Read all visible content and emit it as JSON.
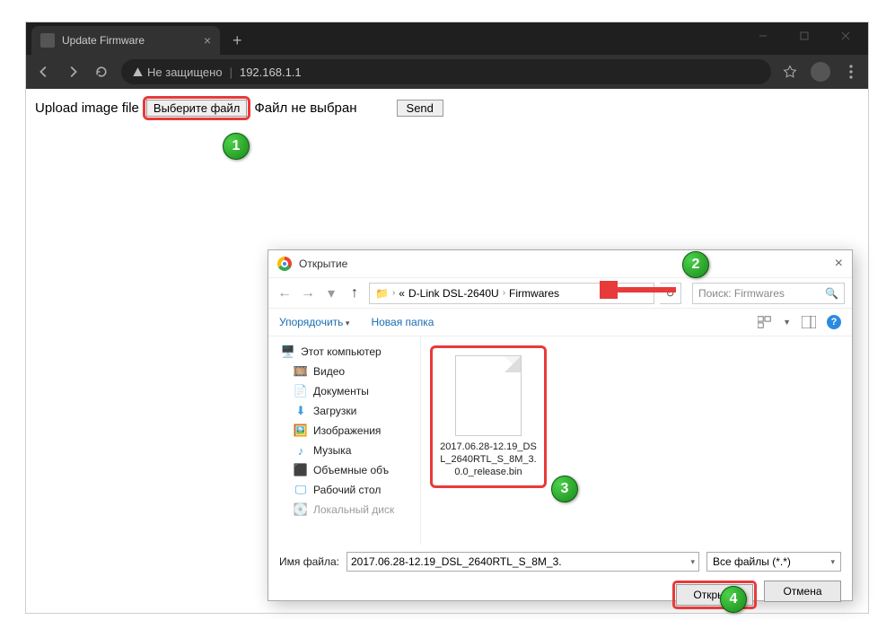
{
  "browser": {
    "tab_title": "Update Firmware",
    "security_label": "Не защищено",
    "url": "192.168.1.1"
  },
  "page": {
    "upload_label": "Upload image file",
    "choose_file_label": "Выберите файл",
    "no_file_label": "Файл не выбран",
    "send_label": "Send"
  },
  "dialog": {
    "title": "Открытие",
    "breadcrumb_prefix": "«",
    "breadcrumb_parent": "D-Link DSL-2640U",
    "breadcrumb_current": "Firmwares",
    "search_placeholder": "Поиск: Firmwares",
    "organize_label": "Упорядочить",
    "new_folder_label": "Новая папка",
    "sidebar": {
      "this_pc": "Этот компьютер",
      "videos": "Видео",
      "documents": "Документы",
      "downloads": "Загрузки",
      "pictures": "Изображения",
      "music": "Музыка",
      "objects3d": "Объемные объ",
      "desktop": "Рабочий стол",
      "local_disk": "Локальный диск"
    },
    "file": {
      "name_display": "2017.06.28-12.19_DSL_2640RTL_S_8M_3.0.0_release.bin"
    },
    "filename_label": "Имя файла:",
    "filename_value": "2017.06.28-12.19_DSL_2640RTL_S_8M_3.",
    "filetype_label": "Все файлы (*.*)",
    "open_label": "Открыть",
    "cancel_label": "Отмена"
  },
  "badges": {
    "b1": "1",
    "b2": "2",
    "b3": "3",
    "b4": "4"
  }
}
